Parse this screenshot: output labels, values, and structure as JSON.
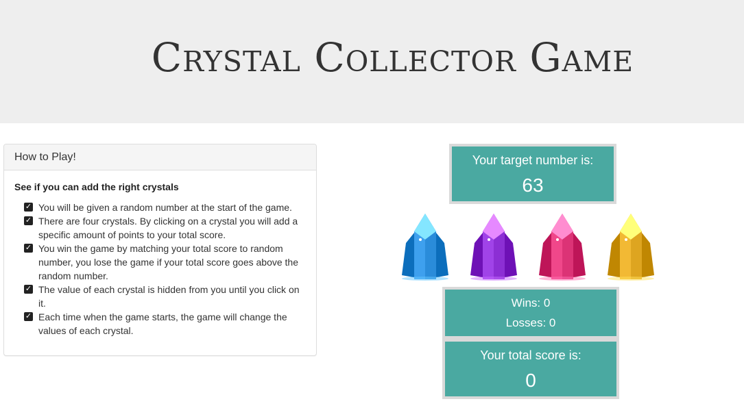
{
  "header": {
    "title": "Crystal Collector Game"
  },
  "instructions": {
    "heading": "How to Play!",
    "subtitle": "See if you can add the right crystals",
    "rules": [
      "You will be given a random number at the start of the game.",
      "There are four crystals. By clicking on a crystal you will add a specific amount of points to your total score.",
      "You win the game by matching your total score to random number, you lose the game if your total score goes above the random number.",
      "The value of each crystal is hidden from you until you click on it.",
      "Each time when the game starts, the game will change the values of each crystal."
    ]
  },
  "target": {
    "label": "Your target number is:",
    "value": "63"
  },
  "crystals": [
    {
      "name": "blue-crystal",
      "color": "#3ea0ee"
    },
    {
      "name": "purple-crystal",
      "color": "#a043e8"
    },
    {
      "name": "pink-crystal",
      "color": "#f0478a"
    },
    {
      "name": "yellow-crystal",
      "color": "#f2b934"
    }
  ],
  "stats": {
    "wins_label": "Wins: 0",
    "losses_label": "Losses: 0"
  },
  "score": {
    "label": "Your total score is:",
    "value": "0"
  },
  "colors": {
    "accent": "#4aa9a1",
    "box_border": "#d9d9d9",
    "jumbotron": "#eeeeee"
  }
}
